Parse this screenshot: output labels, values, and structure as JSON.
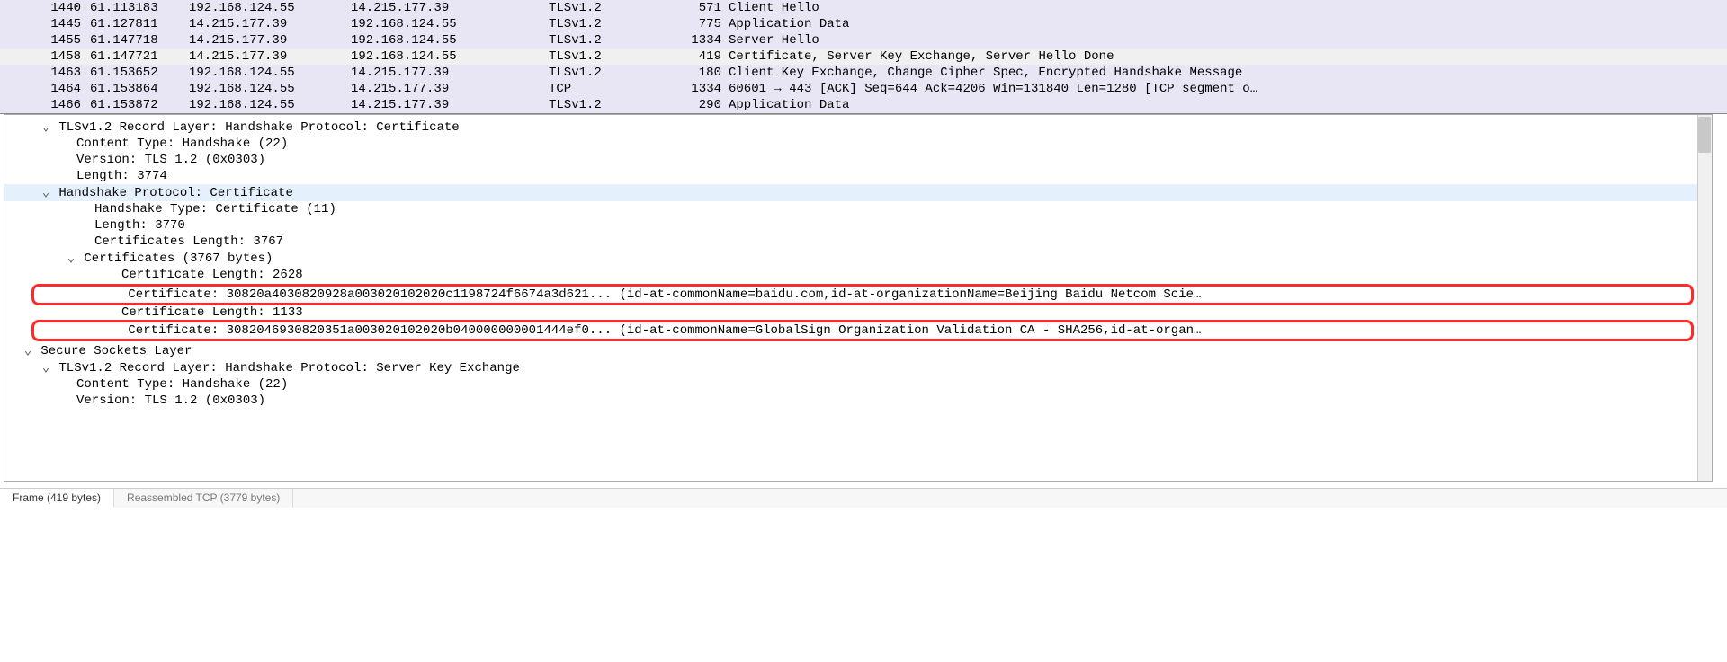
{
  "packets": [
    {
      "no": "1440",
      "time": "61.113183",
      "src": "192.168.124.55",
      "dst": "14.215.177.39",
      "proto": "TLSv1.2",
      "len": "571",
      "info": "Client Hello",
      "sel": false,
      "tcp": false
    },
    {
      "no": "1445",
      "time": "61.127811",
      "src": "14.215.177.39",
      "dst": "192.168.124.55",
      "proto": "TLSv1.2",
      "len": "775",
      "info": "Application Data",
      "sel": false,
      "tcp": false
    },
    {
      "no": "1455",
      "time": "61.147718",
      "src": "14.215.177.39",
      "dst": "192.168.124.55",
      "proto": "TLSv1.2",
      "len": "1334",
      "info": "Server Hello",
      "sel": false,
      "tcp": false
    },
    {
      "no": "1458",
      "time": "61.147721",
      "src": "14.215.177.39",
      "dst": "192.168.124.55",
      "proto": "TLSv1.2",
      "len": "419",
      "info": "Certificate, Server Key Exchange, Server Hello Done",
      "sel": true,
      "tcp": false
    },
    {
      "no": "1463",
      "time": "61.153652",
      "src": "192.168.124.55",
      "dst": "14.215.177.39",
      "proto": "TLSv1.2",
      "len": "180",
      "info": "Client Key Exchange, Change Cipher Spec, Encrypted Handshake Message",
      "sel": false,
      "tcp": false
    },
    {
      "no": "1464",
      "time": "61.153864",
      "src": "192.168.124.55",
      "dst": "14.215.177.39",
      "proto": "TCP",
      "len": "1334",
      "info": "60601 → 443 [ACK] Seq=644 Ack=4206 Win=131840 Len=1280 [TCP segment o…",
      "sel": false,
      "tcp": true
    },
    {
      "no": "1466",
      "time": "61.153872",
      "src": "192.168.124.55",
      "dst": "14.215.177.39",
      "proto": "TLSv1.2",
      "len": "290",
      "info": "Application Data",
      "sel": false,
      "tcp": false
    }
  ],
  "detail": {
    "record_layer": "TLSv1.2 Record Layer: Handshake Protocol: Certificate",
    "content_type": "Content Type: Handshake (22)",
    "version": "Version: TLS 1.2 (0x0303)",
    "length": "Length: 3774",
    "handshake_proto": "Handshake Protocol: Certificate",
    "handshake_type": "Handshake Type: Certificate (11)",
    "hs_length": "Length: 3770",
    "certs_length": "Certificates Length: 3767",
    "certs_node": "Certificates (3767 bytes)",
    "cert1_len": "Certificate Length: 2628",
    "cert1": "Certificate: 30820a4030820928a003020102020c1198724f6674a3d621... (id-at-commonName=baidu.com,id-at-organizationName=Beijing Baidu Netcom Scie…",
    "cert2_len": "Certificate Length: 1133",
    "cert2": "Certificate: 3082046930820351a003020102020b040000000001444ef0... (id-at-commonName=GlobalSign Organization Validation CA - SHA256,id-at-organ…",
    "ssl": "Secure Sockets Layer",
    "record_layer2": "TLSv1.2 Record Layer: Handshake Protocol: Server Key Exchange",
    "content_type2": "Content Type: Handshake (22)",
    "version2": "Version: TLS 1.2 (0x0303)"
  },
  "tabs": {
    "frame": "Frame (419 bytes)",
    "reassembled": "Reassembled TCP (3779 bytes)"
  },
  "carets": {
    "open": "⌄",
    "closed": "›"
  }
}
